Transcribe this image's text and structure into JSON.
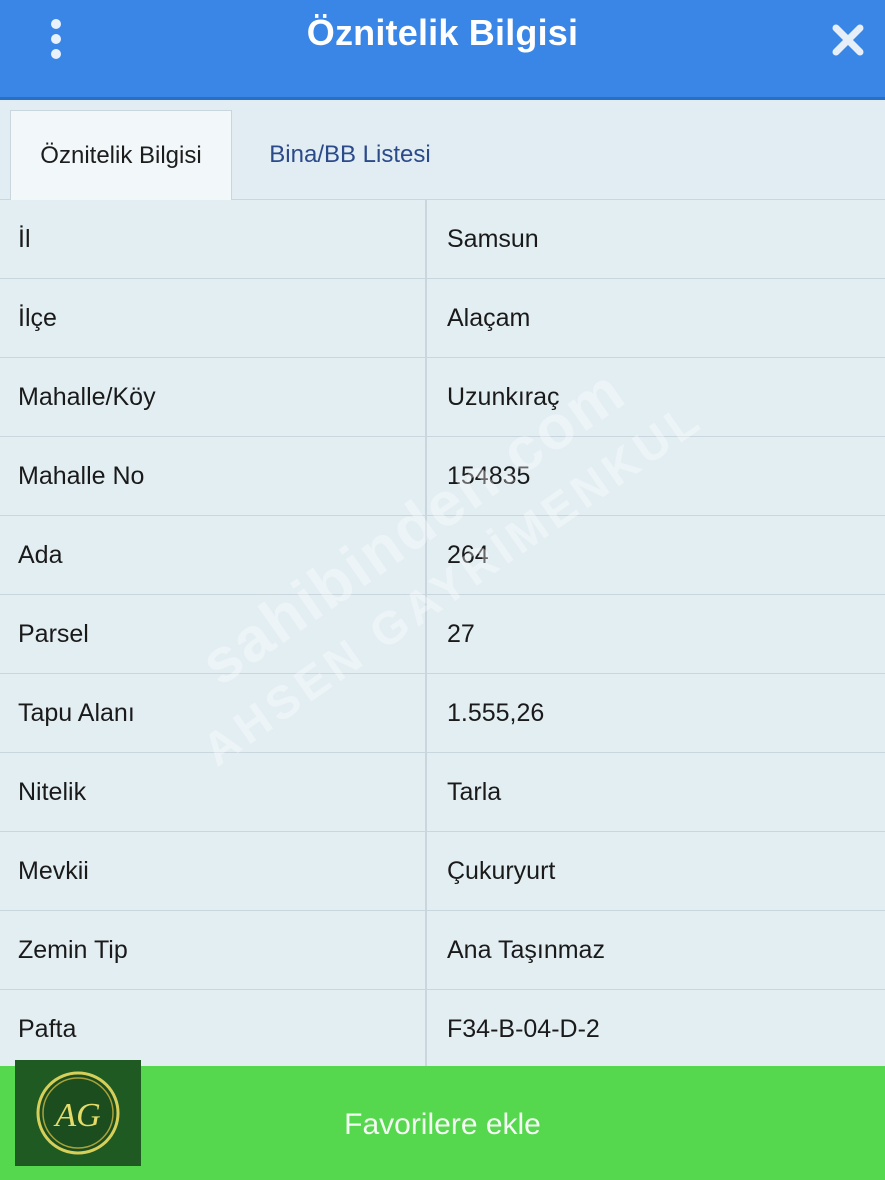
{
  "header": {
    "title": "Öznitelik Bilgisi",
    "menu_icon": "kebab-menu-icon",
    "close_icon": "close-icon",
    "background_color": "#3a86e6"
  },
  "tabs": [
    {
      "label": "Öznitelik Bilgisi",
      "active": true
    },
    {
      "label": "Bina/BB Listesi",
      "active": false
    }
  ],
  "attributes": [
    {
      "key": "İl",
      "value": "Samsun"
    },
    {
      "key": "İlçe",
      "value": "Alaçam"
    },
    {
      "key": "Mahalle/Köy",
      "value": "Uzunkıraç"
    },
    {
      "key": "Mahalle No",
      "value": "154835"
    },
    {
      "key": "Ada",
      "value": "264"
    },
    {
      "key": "Parsel",
      "value": "27"
    },
    {
      "key": "Tapu Alanı",
      "value": "1.555,26"
    },
    {
      "key": "Nitelik",
      "value": "Tarla"
    },
    {
      "key": "Mevkii",
      "value": "Çukuryurt"
    },
    {
      "key": "Zemin Tip",
      "value": "Ana Taşınmaz"
    },
    {
      "key": "Pafta",
      "value": "F34-B-04-D-2"
    }
  ],
  "watermark": {
    "line1": "sahibinden.com",
    "line2": "AHSEN GAYRİMENKUL"
  },
  "footer": {
    "button_label": "Favorilere ekle",
    "background_color": "#55d84e"
  },
  "logo": {
    "text": "AG"
  }
}
